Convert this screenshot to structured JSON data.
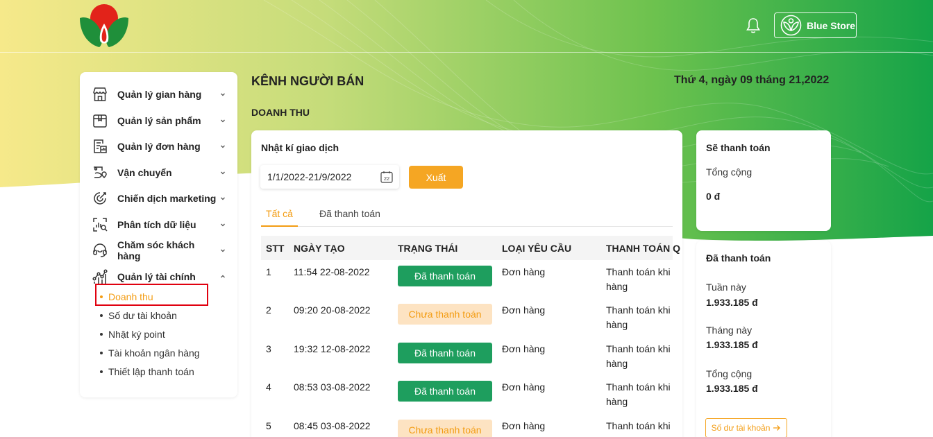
{
  "header": {
    "store_name": "Blue Store"
  },
  "colors": {
    "accent": "#f5a623",
    "paid": "#1e9e5e",
    "unpaid_bg": "#fde3c2",
    "highlight": "#e0000f"
  },
  "sidebar": {
    "items": [
      {
        "label": "Quản lý gian hàng",
        "icon": "store-icon"
      },
      {
        "label": "Quản lý sản phẩm",
        "icon": "box-icon"
      },
      {
        "label": "Quản lý đơn hàng",
        "icon": "order-icon"
      },
      {
        "label": "Vận chuyển",
        "icon": "shipping-icon"
      },
      {
        "label": "Chiến dịch marketing",
        "icon": "campaign-icon"
      },
      {
        "label": "Phân tích dữ liệu",
        "icon": "analytics-icon"
      },
      {
        "label": "Chăm sóc khách hàng",
        "icon": "headset-icon"
      },
      {
        "label": "Quản lý tài chính",
        "icon": "finance-icon"
      }
    ],
    "sub_items": [
      {
        "label": "Doanh thu",
        "active": true
      },
      {
        "label": "Số dư tài khoản",
        "active": false
      },
      {
        "label": "Nhật ký point",
        "active": false
      },
      {
        "label": "Tài khoản ngân hàng",
        "active": false
      },
      {
        "label": "Thiết lập thanh toán",
        "active": false
      }
    ]
  },
  "main": {
    "page_title": "KÊNH NGƯỜI BÁN",
    "date": "Thứ 4, ngày 09 tháng 21,2022",
    "section_title": "DOANH THU",
    "card_title": "Nhật kí giao dịch",
    "date_range": "1/1/2022-21/9/2022",
    "calendar_day": "22",
    "export_label": "Xuất",
    "tabs": [
      {
        "label": "Tất cả",
        "active": true
      },
      {
        "label": "Đã thanh toán",
        "active": false
      }
    ],
    "table": {
      "headers": [
        "STT",
        "NGÀY TẠO",
        "TRẠNG THÁI",
        "LOẠI YÊU CẦU",
        "THANH TOÁN Q"
      ],
      "rows": [
        {
          "stt": "1",
          "date": "11:54 22-08-2022",
          "status": "Đã thanh toán",
          "status_type": "paid",
          "type": "Đơn hàng",
          "payment": "Thanh toán khi hàng"
        },
        {
          "stt": "2",
          "date": "09:20 20-08-2022",
          "status": "Chưa thanh toán",
          "status_type": "unpaid",
          "type": "Đơn hàng",
          "payment": "Thanh toán khi hàng"
        },
        {
          "stt": "3",
          "date": "19:32 12-08-2022",
          "status": "Đã thanh toán",
          "status_type": "paid",
          "type": "Đơn hàng",
          "payment": "Thanh toán khi hàng"
        },
        {
          "stt": "4",
          "date": "08:53 03-08-2022",
          "status": "Đã thanh toán",
          "status_type": "paid",
          "type": "Đơn hàng",
          "payment": "Thanh toán khi hàng"
        },
        {
          "stt": "5",
          "date": "08:45 03-08-2022",
          "status": "Chưa thanh toán",
          "status_type": "unpaid",
          "type": "Đơn hàng",
          "payment": "Thanh toán khi hàng"
        }
      ]
    }
  },
  "upcoming": {
    "title": "Sẽ thanh toán",
    "total_label": "Tổng cộng",
    "total_value": "0 đ"
  },
  "paid_summary": {
    "title": "Đã thanh toán",
    "week_label": "Tuần này",
    "week_value": "1.933.185 đ",
    "month_label": "Tháng này",
    "month_value": "1.933.185 đ",
    "total_label": "Tổng cộng",
    "total_value": "1.933.185 đ",
    "balance_button": "Số dư tài khoản"
  }
}
